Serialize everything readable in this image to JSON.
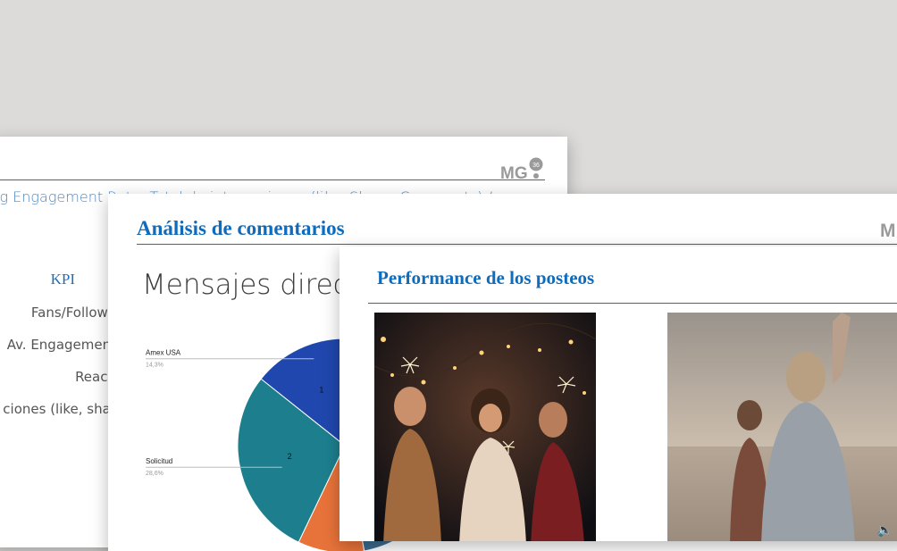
{
  "back_slide": {
    "logo_text": "MG",
    "logo_badge": "36",
    "title_text": "vg Engagement Rate: Total de interacciones (like, Share, Comments) / ...",
    "kpi_header": "KPI",
    "kpi_rows": [
      "Fans/Followe",
      "Av. Engagement",
      "Reach",
      "ciones (like, shar"
    ]
  },
  "middle_slide": {
    "title": "Análisis de comentarios",
    "logo_text": "M",
    "subtitle": "Mensajes direct",
    "chart_data": {
      "type": "pie",
      "title": "",
      "slices": [
        {
          "label": "Amex USA",
          "pct_label": "14,3%",
          "value": 14.3,
          "number": "1",
          "color": "#2047ad"
        },
        {
          "label": "Solicitud",
          "pct_label": "28,6%",
          "value": 28.6,
          "number": "2",
          "color": "#1d7f8e"
        },
        {
          "label": "",
          "pct_label": "",
          "value": 10.0,
          "number": "",
          "color": "#e8733a"
        },
        {
          "label": "",
          "pct_label": "",
          "value": 47.1,
          "number": "",
          "color": "#3d6b8e"
        }
      ]
    }
  },
  "front_slide": {
    "title": "Performance de los posteos",
    "photos": [
      {
        "name": "party-photo"
      },
      {
        "name": "beach-photo",
        "overlay_icon": "volume-icon"
      }
    ]
  }
}
